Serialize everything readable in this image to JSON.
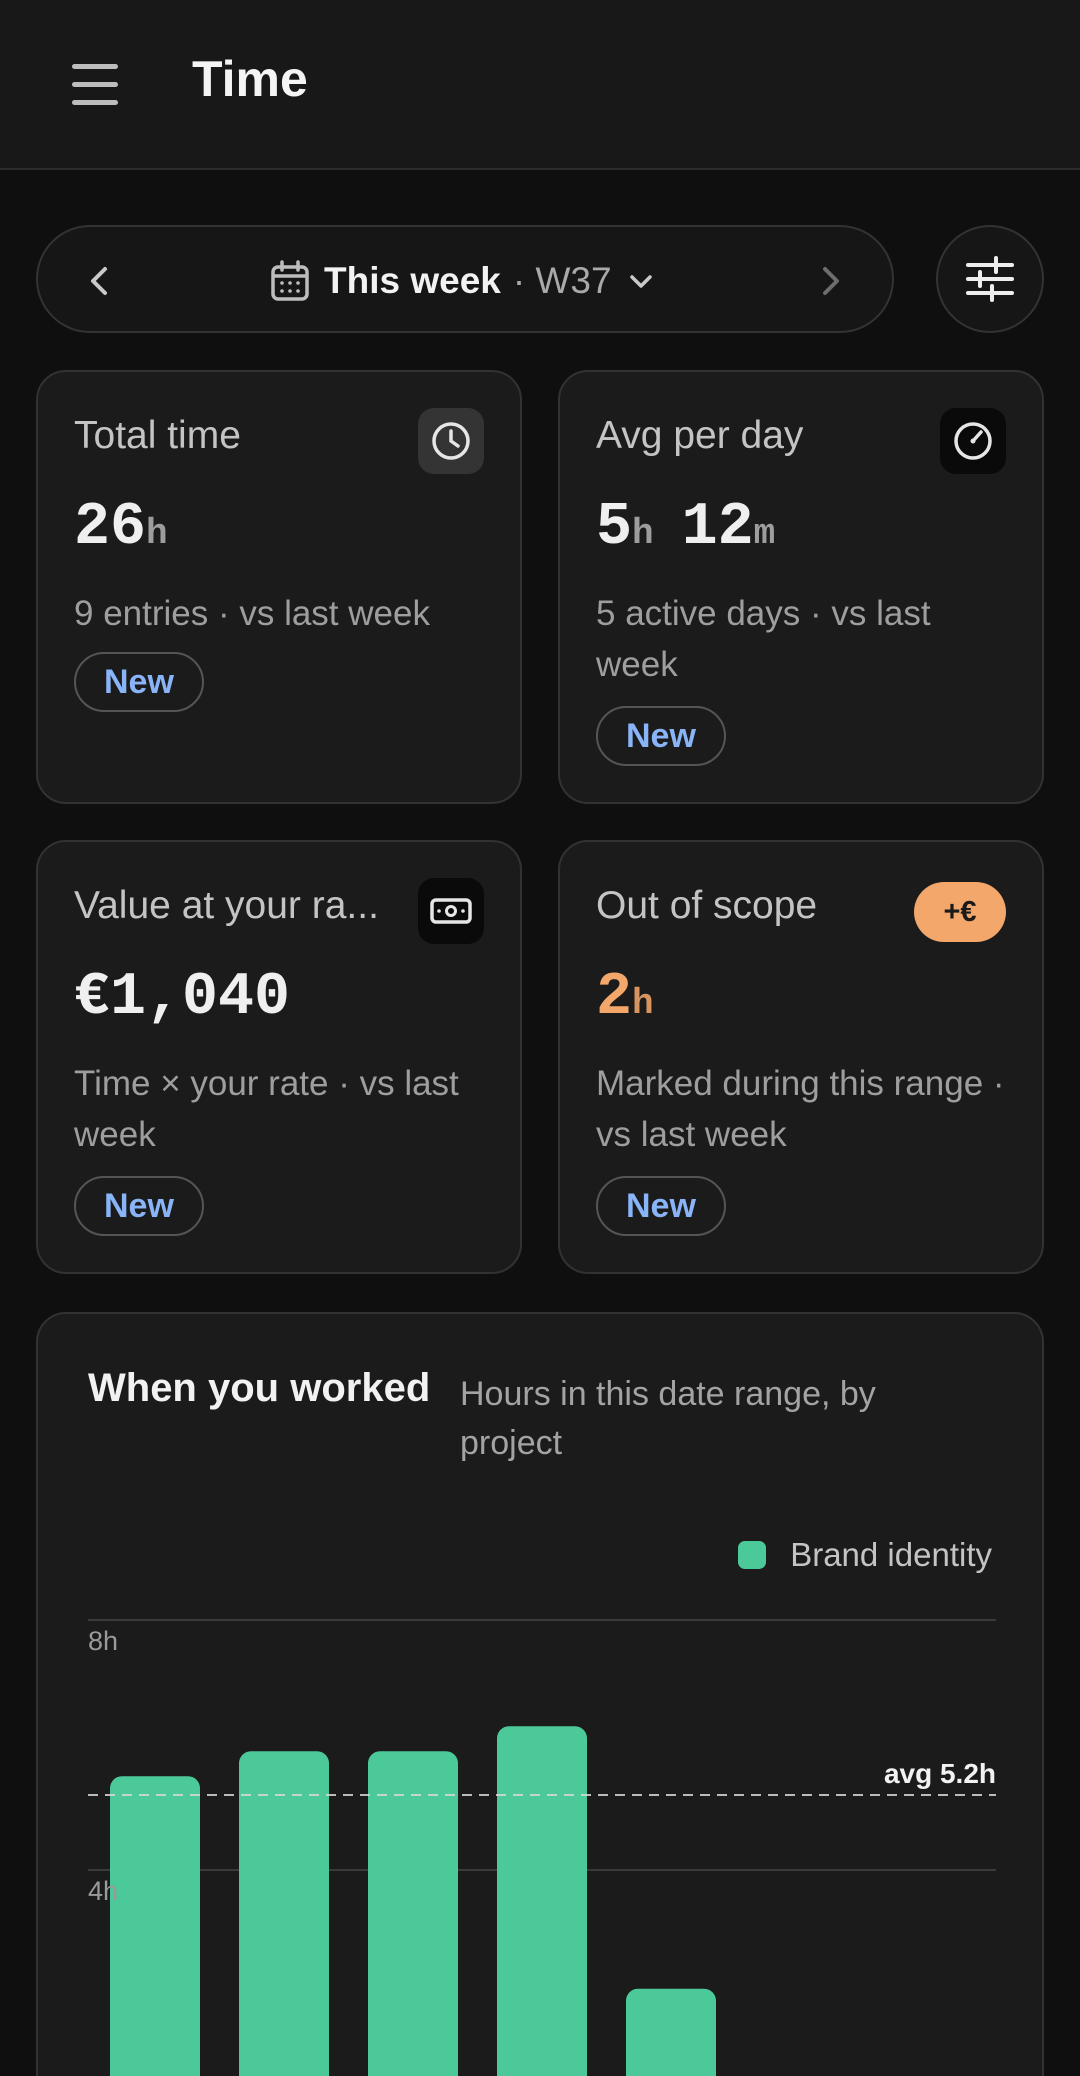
{
  "app": {
    "title": "Time"
  },
  "range": {
    "label": "This week",
    "week": "· W37",
    "prev_icon": "chevron-left-icon",
    "next_icon": "chevron-right-icon"
  },
  "colors": {
    "accent_green": "#4cc999",
    "accent_orange": "#f3a76a",
    "badge_blue": "#8ab4f8"
  },
  "cards": {
    "total_time": {
      "title": "Total time",
      "value": "26",
      "unit": "h",
      "sub": "9 entries · vs last week",
      "badge": "New",
      "icon": "clock-icon"
    },
    "avg_per_day": {
      "title": "Avg per day",
      "value1": "5",
      "unit1": "h",
      "value2": "12",
      "unit2": "m",
      "sub": "5 active days · vs last week",
      "badge": "New",
      "icon": "gauge-icon"
    },
    "value_rate": {
      "title": "Value at your ra...",
      "value": "€1,040",
      "sub": "Time × your rate · vs last week",
      "badge": "New",
      "icon": "cash-icon"
    },
    "out_of_scope": {
      "title": "Out of scope",
      "value": "2",
      "unit": "h",
      "sub": "Marked during this range · vs last week",
      "badge": "New",
      "scope_badge": "+€"
    }
  },
  "chart": {
    "title": "When you worked",
    "subtitle": "Hours in this date range, by project"
  },
  "chart_data": {
    "type": "bar",
    "title": "When you worked",
    "subtitle": "Hours in this date range, by project",
    "series": [
      {
        "name": "Brand identity",
        "values": [
          5.5,
          5.9,
          5.9,
          6.3,
          2.1
        ]
      }
    ],
    "y_ticks": [
      "8h",
      "4h"
    ],
    "ylim": [
      0,
      8
    ],
    "average": {
      "value": 5.2,
      "label": "avg 5.2h"
    },
    "legend_position": "top-right",
    "grid": true
  }
}
